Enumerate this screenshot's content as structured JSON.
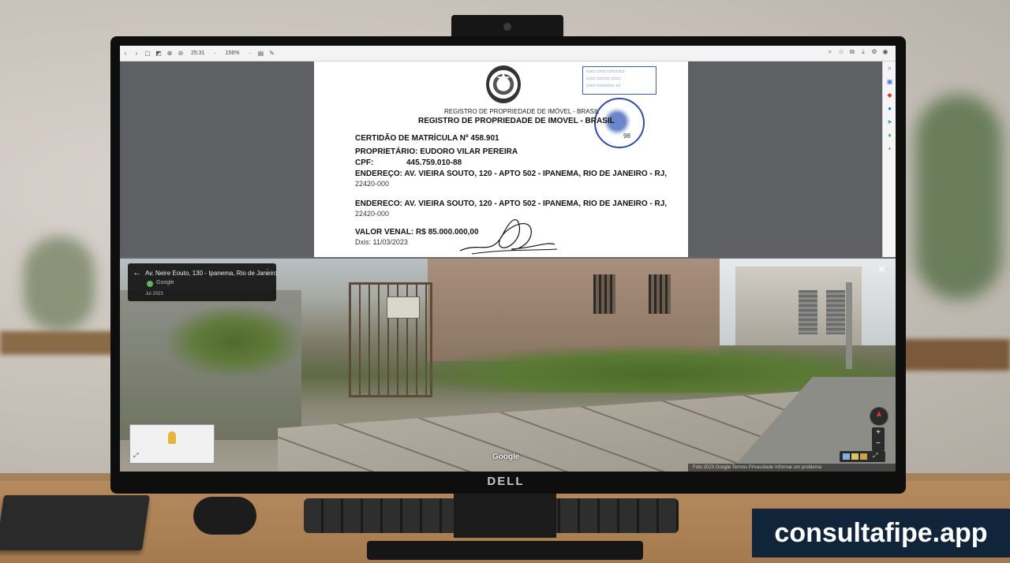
{
  "toolbar": {
    "zoom_level": "25:31",
    "zoom_percent": "156%"
  },
  "document": {
    "issuer_small": "REGISTRO DE PROPRIEDADE DE IMÓVEL - BRASIL",
    "issuer_heading": "REGISTRO DE PROPRIEDADE DE IMOVEL - BRASIL",
    "certificate": "CERTIDÃO DE MATRÍCULA Nº 458.901",
    "owner": "PROPRIETÁRIO: EUDORO VILAR PEREIRA",
    "cpf_label": "CPF:",
    "cpf_value": "445.759.010-88",
    "address_1": "ENDEREÇO:   AV. VIEIRA SOUTO, 120 - APTO 502 - IPANEMA, RIO DE JANEIRO - RJ,",
    "address_1_cep": "22420-000",
    "address_2": "ENDERECO:   AV. VIEIRA SOUTO, 120 - APTO 502 - IPANEMA, RIO DE JANEIRO - RJ,",
    "address_2_cep": "22420-000",
    "valor": "VALOR VENAL: R$ 85.000.000,00",
    "data": "Dxis: 11/03/2023",
    "stamp_suffix": "98"
  },
  "street_view": {
    "title": "Av. Neire Eouto, 130 - Ipanema, Rio de Janeiro",
    "source": "Google",
    "date": "Jul 2023",
    "watermark": "Google",
    "footer": "Foto 2023  Google  Termos  Privacidade  Informar um problema"
  },
  "monitor": {
    "brand": "DELL"
  },
  "badge": {
    "text": "consultafipe.app"
  }
}
